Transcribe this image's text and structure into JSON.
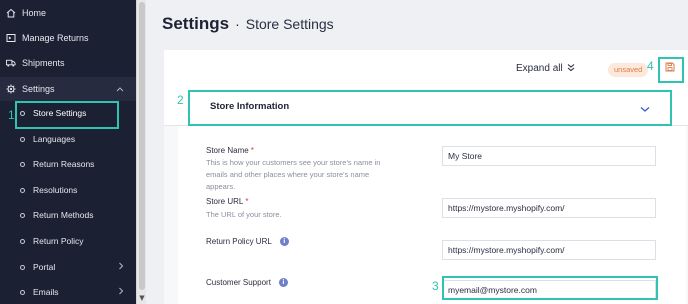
{
  "sidebar": {
    "items": [
      {
        "label": "Home",
        "icon": "home-icon"
      },
      {
        "label": "Manage Returns",
        "icon": "returns-box-icon"
      },
      {
        "label": "Shipments",
        "icon": "truck-icon"
      },
      {
        "label": "Settings",
        "icon": "gear-icon"
      }
    ],
    "settings_submenu": [
      {
        "label": "Store Settings"
      },
      {
        "label": "Languages"
      },
      {
        "label": "Return Reasons"
      },
      {
        "label": "Resolutions"
      },
      {
        "label": "Return Methods"
      },
      {
        "label": "Return Policy"
      },
      {
        "label": "Portal"
      },
      {
        "label": "Emails"
      }
    ]
  },
  "header": {
    "title": "Settings",
    "separator": "·",
    "subtitle": "Store Settings"
  },
  "toolbar": {
    "expand_all": "Expand all",
    "unsaved_badge": "unsaved"
  },
  "section": {
    "title": "Store Information"
  },
  "form": {
    "store_name": {
      "label": "Store Name",
      "required": "*",
      "help": "This is how your customers see your store's name in emails and other places where your store's name appears.",
      "value": "My Store"
    },
    "store_url": {
      "label": "Store URL",
      "required": "*",
      "help": "The URL of your store.",
      "value": "https://mystore.myshopify.com/"
    },
    "return_policy_url": {
      "label": "Return Policy URL",
      "value": "https://mystore.myshopify.com/"
    },
    "customer_support": {
      "label": "Customer Support",
      "value": "myemail@mystore.com"
    }
  },
  "annotations": {
    "n1": "1",
    "n2": "2",
    "n3": "3",
    "n4": "4",
    "color": "#2fc4b2"
  },
  "colors": {
    "sidebar_bg": "#1c2033",
    "accent_blue": "#3a5bd0",
    "unsaved_orange": "#e07a45",
    "required_red": "#d23b3b"
  }
}
